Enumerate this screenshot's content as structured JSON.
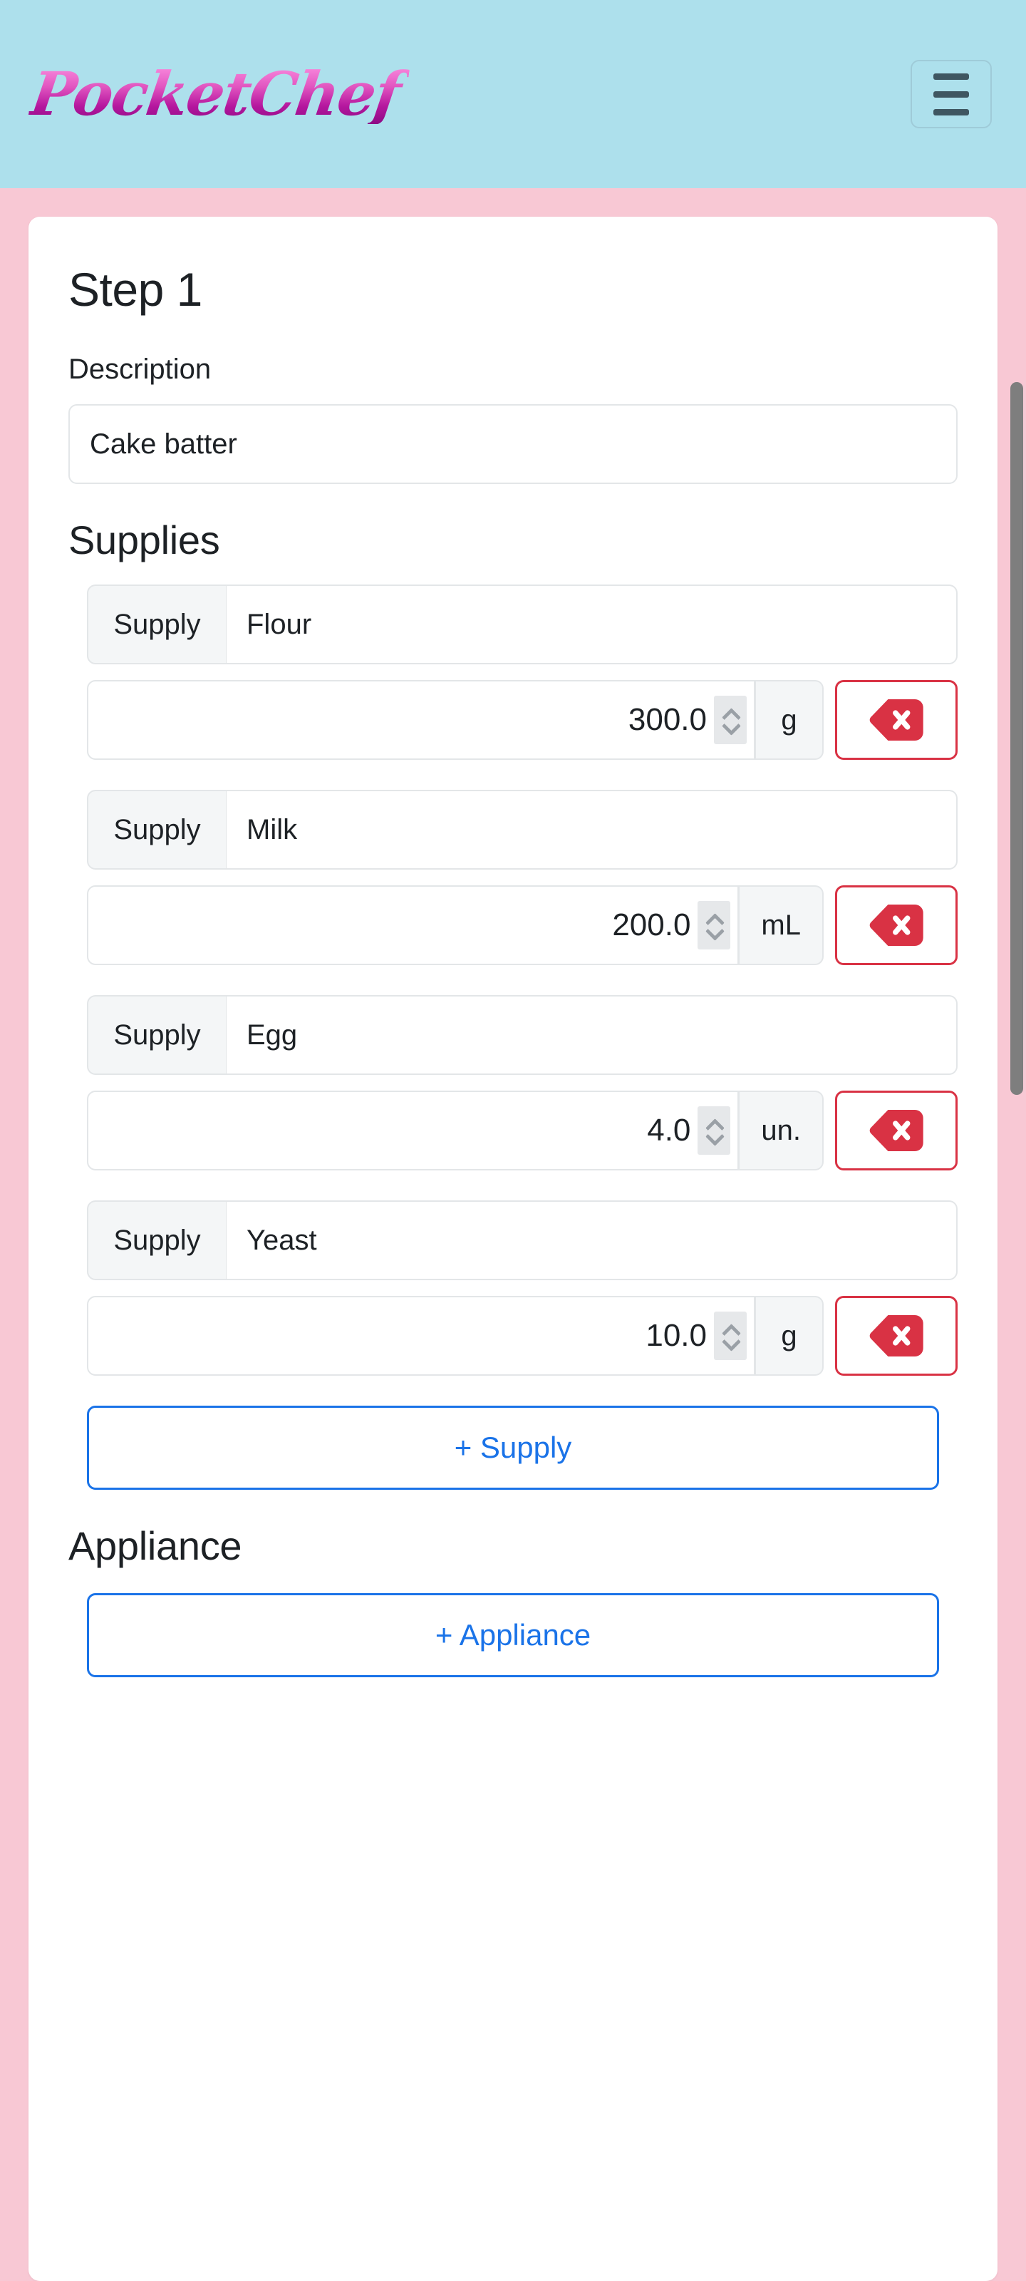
{
  "header": {
    "brand": "PocketChef",
    "menu_icon": "hamburger-menu-icon",
    "background_color": "#ade0ec"
  },
  "page": {
    "background_color": "#f8c8d4",
    "card_background": "#ffffff"
  },
  "step": {
    "title": "Step 1",
    "description_label": "Description",
    "description_value": "Cake batter",
    "description_placeholder": ""
  },
  "supplies_section": {
    "heading": "Supplies",
    "supply_prefix_label": "Supply",
    "add_button_label": "+ Supply",
    "delete_icon": "backspace-delete-icon",
    "spinner_icon": "stepper-chevrons-icon",
    "items": [
      {
        "name": "Flour",
        "quantity": "300.0",
        "unit": "g"
      },
      {
        "name": "Milk",
        "quantity": "200.0",
        "unit": "mL"
      },
      {
        "name": "Egg",
        "quantity": "4.0",
        "unit": "un."
      },
      {
        "name": "Yeast",
        "quantity": "10.0",
        "unit": "g"
      }
    ]
  },
  "appliance_section": {
    "heading": "Appliance",
    "add_button_label": "+ Appliance"
  },
  "colors": {
    "accent_blue": "#1a73e8",
    "danger_red": "#d93244",
    "header_blue": "#ade0ec",
    "page_pink": "#f8c8d4",
    "brand_gradient_from": "#fb8fe0",
    "brand_gradient_to": "#8d0b85"
  },
  "scrollbar": {
    "thumb_color": "#7e7e7e"
  }
}
